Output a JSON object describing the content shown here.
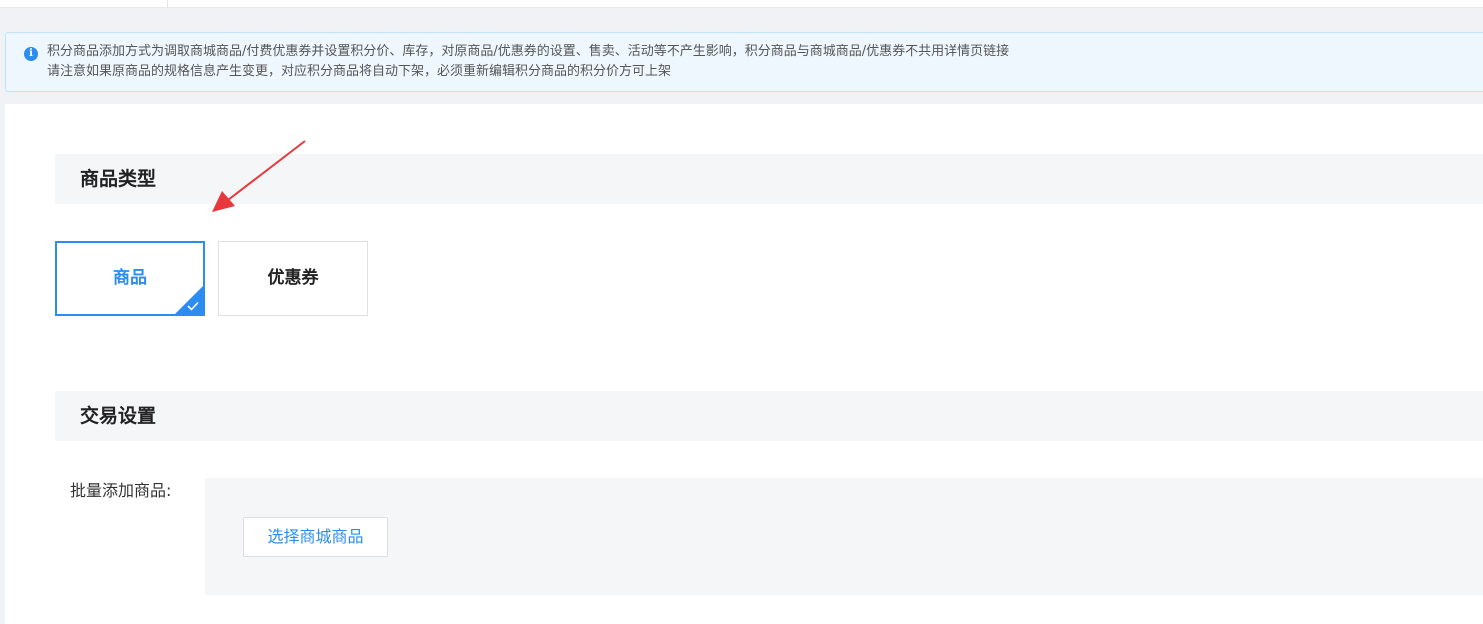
{
  "notice": {
    "line1": "积分商品添加方式为调取商城商品/付费优惠券并设置积分价、库存，对原商品/优惠券的设置、售卖、活动等不产生影响，积分商品与商城商品/优惠券不共用详情页链接",
    "line2": "请注意如果原商品的规格信息产生变更，对应积分商品将自动下架，必须重新编辑积分商品的积分价方可上架",
    "icon": "info-icon"
  },
  "product_type": {
    "title": "商品类型",
    "options": [
      {
        "label": "商品",
        "selected": true
      },
      {
        "label": "优惠券",
        "selected": false
      }
    ]
  },
  "trade_settings": {
    "title": "交易设置",
    "batch_add_label": "批量添加商品:",
    "select_button": "选择商城商品"
  },
  "colors": {
    "accent": "#2d8cf0",
    "annotation_arrow": "#e8383d"
  }
}
